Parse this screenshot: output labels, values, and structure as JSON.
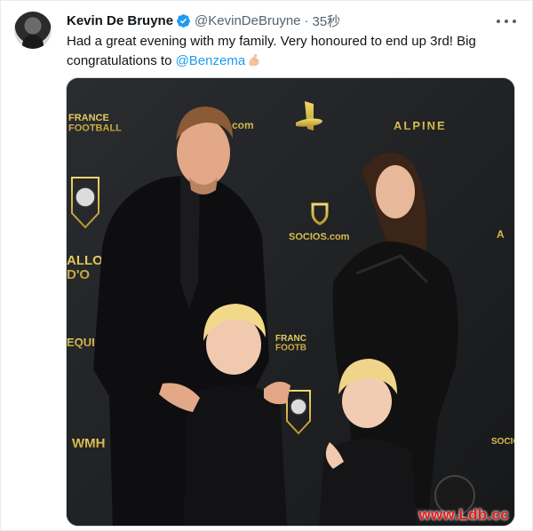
{
  "tweet": {
    "author_name": "Kevin De Bruyne",
    "handle": "@KevinDeBruyne",
    "separator": "·",
    "time": "35秒",
    "text_part1": "Had a great evening with my family. Very honoured to end up 3rd! Big congratulations to ",
    "mention": "@Benzema",
    "emoji_name": "flexed-biceps-icon",
    "verified_color": "#1d9bf0",
    "link_color": "#1d9bf0"
  },
  "photo": {
    "backdrop_texts": {
      "france_football_top": "FRANCE\nFOOTBALL",
      "alpine": "ALPINE",
      "socios": "SOCIOS.com",
      "ballon_left": "ALLO\nD'O",
      "equipe": "EQUIPE",
      "france_mid": "FRANC\nFOOTB",
      "wmh": "WMH",
      "socio_right": "SOCIO",
      "a_right": "A",
      "com_top": "com"
    }
  },
  "watermark": "www.Ldb.cc"
}
